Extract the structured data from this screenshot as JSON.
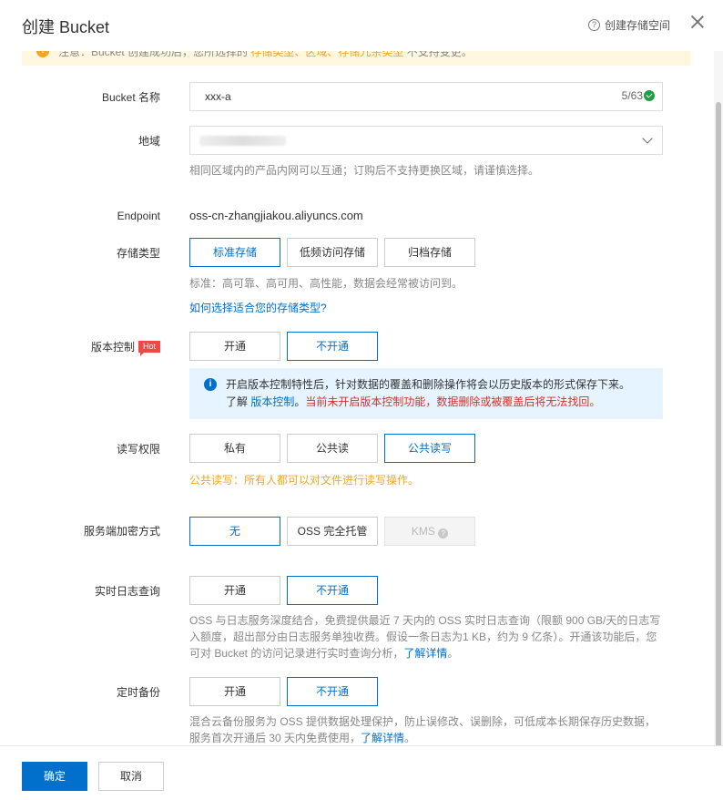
{
  "header": {
    "title": "创建 Bucket",
    "help_link": "创建存储空间"
  },
  "notice": {
    "text": "注意：Bucket 创建成功后，您所选择的 ",
    "highlight": "存储类型、区域、存储冗余类型",
    "text_end": " 不支持变更。"
  },
  "form": {
    "bucket_name": {
      "label": "Bucket 名称",
      "value": "xxx-a",
      "count": "5/63"
    },
    "region": {
      "label": "地域",
      "hint": "相同区域内的产品内网可以互通；订购后不支持更换区域，请谨慎选择。"
    },
    "endpoint": {
      "label": "Endpoint",
      "value": "oss-cn-zhangjiakou.aliyuncs.com"
    },
    "storage_class": {
      "label": "存储类型",
      "options": [
        "标准存储",
        "低频访问存储",
        "归档存储"
      ],
      "selected": "标准存储",
      "hint": "标准：高可靠、高可用、高性能，数据会经常被访问到。",
      "help_link": "如何选择适合您的存储类型?"
    },
    "versioning": {
      "label": "版本控制",
      "badge": "Hot",
      "options": [
        "开通",
        "不开通"
      ],
      "selected": "不开通",
      "info_line1": "开启版本控制特性后，针对数据的覆盖和删除操作将会以历史版本的形式保存下来。",
      "info_prefix": "了解 ",
      "info_link": "版本控制",
      "info_suffix": "。",
      "info_warning": "当前未开启版本控制功能，数据删除或被覆盖后将无法找回。"
    },
    "acl": {
      "label": "读写权限",
      "options": [
        "私有",
        "公共读",
        "公共读写"
      ],
      "selected": "公共读写",
      "warning": "公共读写：所有人都可以对文件进行读写操作。"
    },
    "encryption": {
      "label": "服务端加密方式",
      "options": [
        "无",
        "OSS 完全托管",
        "KMS"
      ],
      "selected": "无",
      "disabled": "KMS"
    },
    "realtime_log": {
      "label": "实时日志查询",
      "options": [
        "开通",
        "不开通"
      ],
      "selected": "不开通",
      "desc_line1": "OSS 与日志服务深度结合，免费提供最近 7 天内的 OSS 实时日志查询（限额 900 GB/天的日志写",
      "desc_line2": "入额度，超出部分由日志服务单独收费。假设一条日志为1 KB，约为 9 亿条）。开通该功能后，您",
      "desc_line3": "可对 Bucket 的访问记录进行实时查询分析，",
      "desc_link": "了解详情",
      "desc_end": "。"
    },
    "backup": {
      "label": "定时备份",
      "options": [
        "开通",
        "不开通"
      ],
      "selected": "不开通",
      "desc_line1": "混合云备份服务为 OSS 提供数据处理保护，防止误修改、误删除，可低成本长期保存历史数据，",
      "desc_line2": "服务首次开通后 30 天内免费使用，",
      "desc_link": "了解详情",
      "desc_end": "。"
    }
  },
  "footer": {
    "confirm": "确定",
    "cancel": "取消"
  }
}
